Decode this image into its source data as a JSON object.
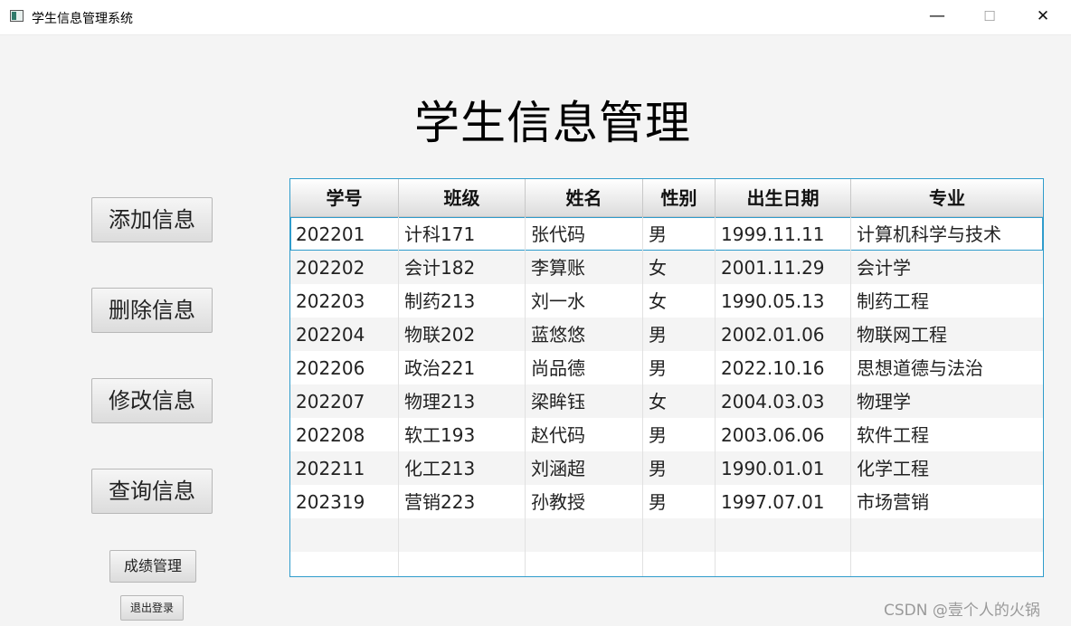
{
  "window": {
    "title": "学生信息管理系统",
    "min_glyph": "—",
    "max_glyph": "☐",
    "close_glyph": "✕"
  },
  "page_title": "学生信息管理",
  "actions": {
    "add": "添加信息",
    "delete": "删除信息",
    "modify": "修改信息",
    "query": "查询信息",
    "grades": "成绩管理",
    "logout": "退出登录"
  },
  "table": {
    "columns": [
      "学号",
      "班级",
      "姓名",
      "性别",
      "出生日期",
      "专业"
    ],
    "rows": [
      [
        "202201",
        "计科171",
        "张代码",
        "男",
        "1999.11.11",
        "计算机科学与技术"
      ],
      [
        "202202",
        "会计182",
        "李算账",
        "女",
        "2001.11.29",
        "会计学"
      ],
      [
        "202203",
        "制药213",
        "刘一水",
        "女",
        "1990.05.13",
        "制药工程"
      ],
      [
        "202204",
        "物联202",
        "蓝悠悠",
        "男",
        "2002.01.06",
        "物联网工程"
      ],
      [
        "202206",
        "政治221",
        "尚品德",
        "男",
        "2022.10.16",
        "思想道德与法治"
      ],
      [
        "202207",
        "物理213",
        "梁眸钰",
        "女",
        "2004.03.03",
        "物理学"
      ],
      [
        "202208",
        "软工193",
        "赵代码",
        "男",
        "2003.06.06",
        "软件工程"
      ],
      [
        "202211",
        "化工213",
        "刘涵超",
        "男",
        "1990.01.01",
        "化学工程"
      ],
      [
        "202319",
        "营销223",
        "孙教授",
        "男",
        "1997.07.01",
        "市场营销"
      ]
    ],
    "selected_row": 0,
    "accent_color": "#2f9ccc"
  },
  "watermark": "CSDN @壹个人的火锅"
}
